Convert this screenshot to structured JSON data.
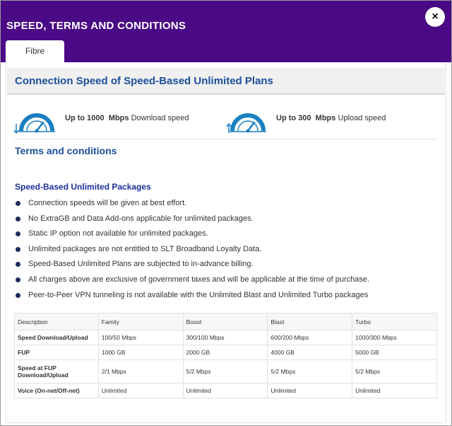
{
  "modal": {
    "title": "SPEED, TERMS AND CONDITIONS",
    "close_label": "×",
    "tabs": [
      {
        "label": "Fibre"
      }
    ]
  },
  "speed_section": {
    "title": "Connection Speed of Speed-Based Unlimited Plans",
    "download": {
      "prefix": "Up to",
      "value": "1000",
      "unit": "Mbps",
      "label": "Download speed",
      "icon": "download-speedometer-icon"
    },
    "upload": {
      "prefix": "Up to",
      "value": "300",
      "unit": "Mbps",
      "label": "Upload speed",
      "icon": "upload-speedometer-icon"
    }
  },
  "terms": {
    "title": "Terms and conditions",
    "package_title": "Speed-Based Unlimited Packages",
    "bullets": [
      "Connection speeds will be given at best effort.",
      "No ExtraGB and Data Add-ons applicable for unlimited packages.",
      "Static IP option not available for unlimited packages.",
      "Unlimited packages are not entitled to SLT Broadband Loyalty Data.",
      "Speed-Based Unlimited Plans are subjected to in-advance billing.",
      "All charges above are exclusive of government taxes and will be applicable at the time of purchase.",
      "Peer-to-Peer VPN tunneling is not available with the Unlimited Blast and Unlimited Turbo packages"
    ]
  },
  "table": {
    "headers": [
      "Description",
      "Family",
      "Boost",
      "Blast",
      "Turbo"
    ],
    "rows": [
      {
        "label": "Speed Download/Upload",
        "values": [
          "100/50 Mbps",
          "300/100 Mbps",
          "600/200 Mbps",
          "1000/300 Mbps"
        ]
      },
      {
        "label": "FUP",
        "values": [
          "1000 GB",
          "2000 GB",
          "4000 GB",
          "5000 GB"
        ]
      },
      {
        "label": "Speed at FUP Download/Upload",
        "values": [
          "2/1 Mbps",
          "5/2 Mbps",
          "5/2 Mbps",
          "5/2 Mbps"
        ]
      },
      {
        "label": "Voice (On-net/Off-net)",
        "values": [
          "Unlimited",
          "Unlimited",
          "Unlimited",
          "Unlimited"
        ]
      }
    ]
  },
  "colors": {
    "header_bg": "#4a0a86",
    "accent_blue": "#1c4f9c",
    "gauge_blue": "#1a7fc1"
  }
}
